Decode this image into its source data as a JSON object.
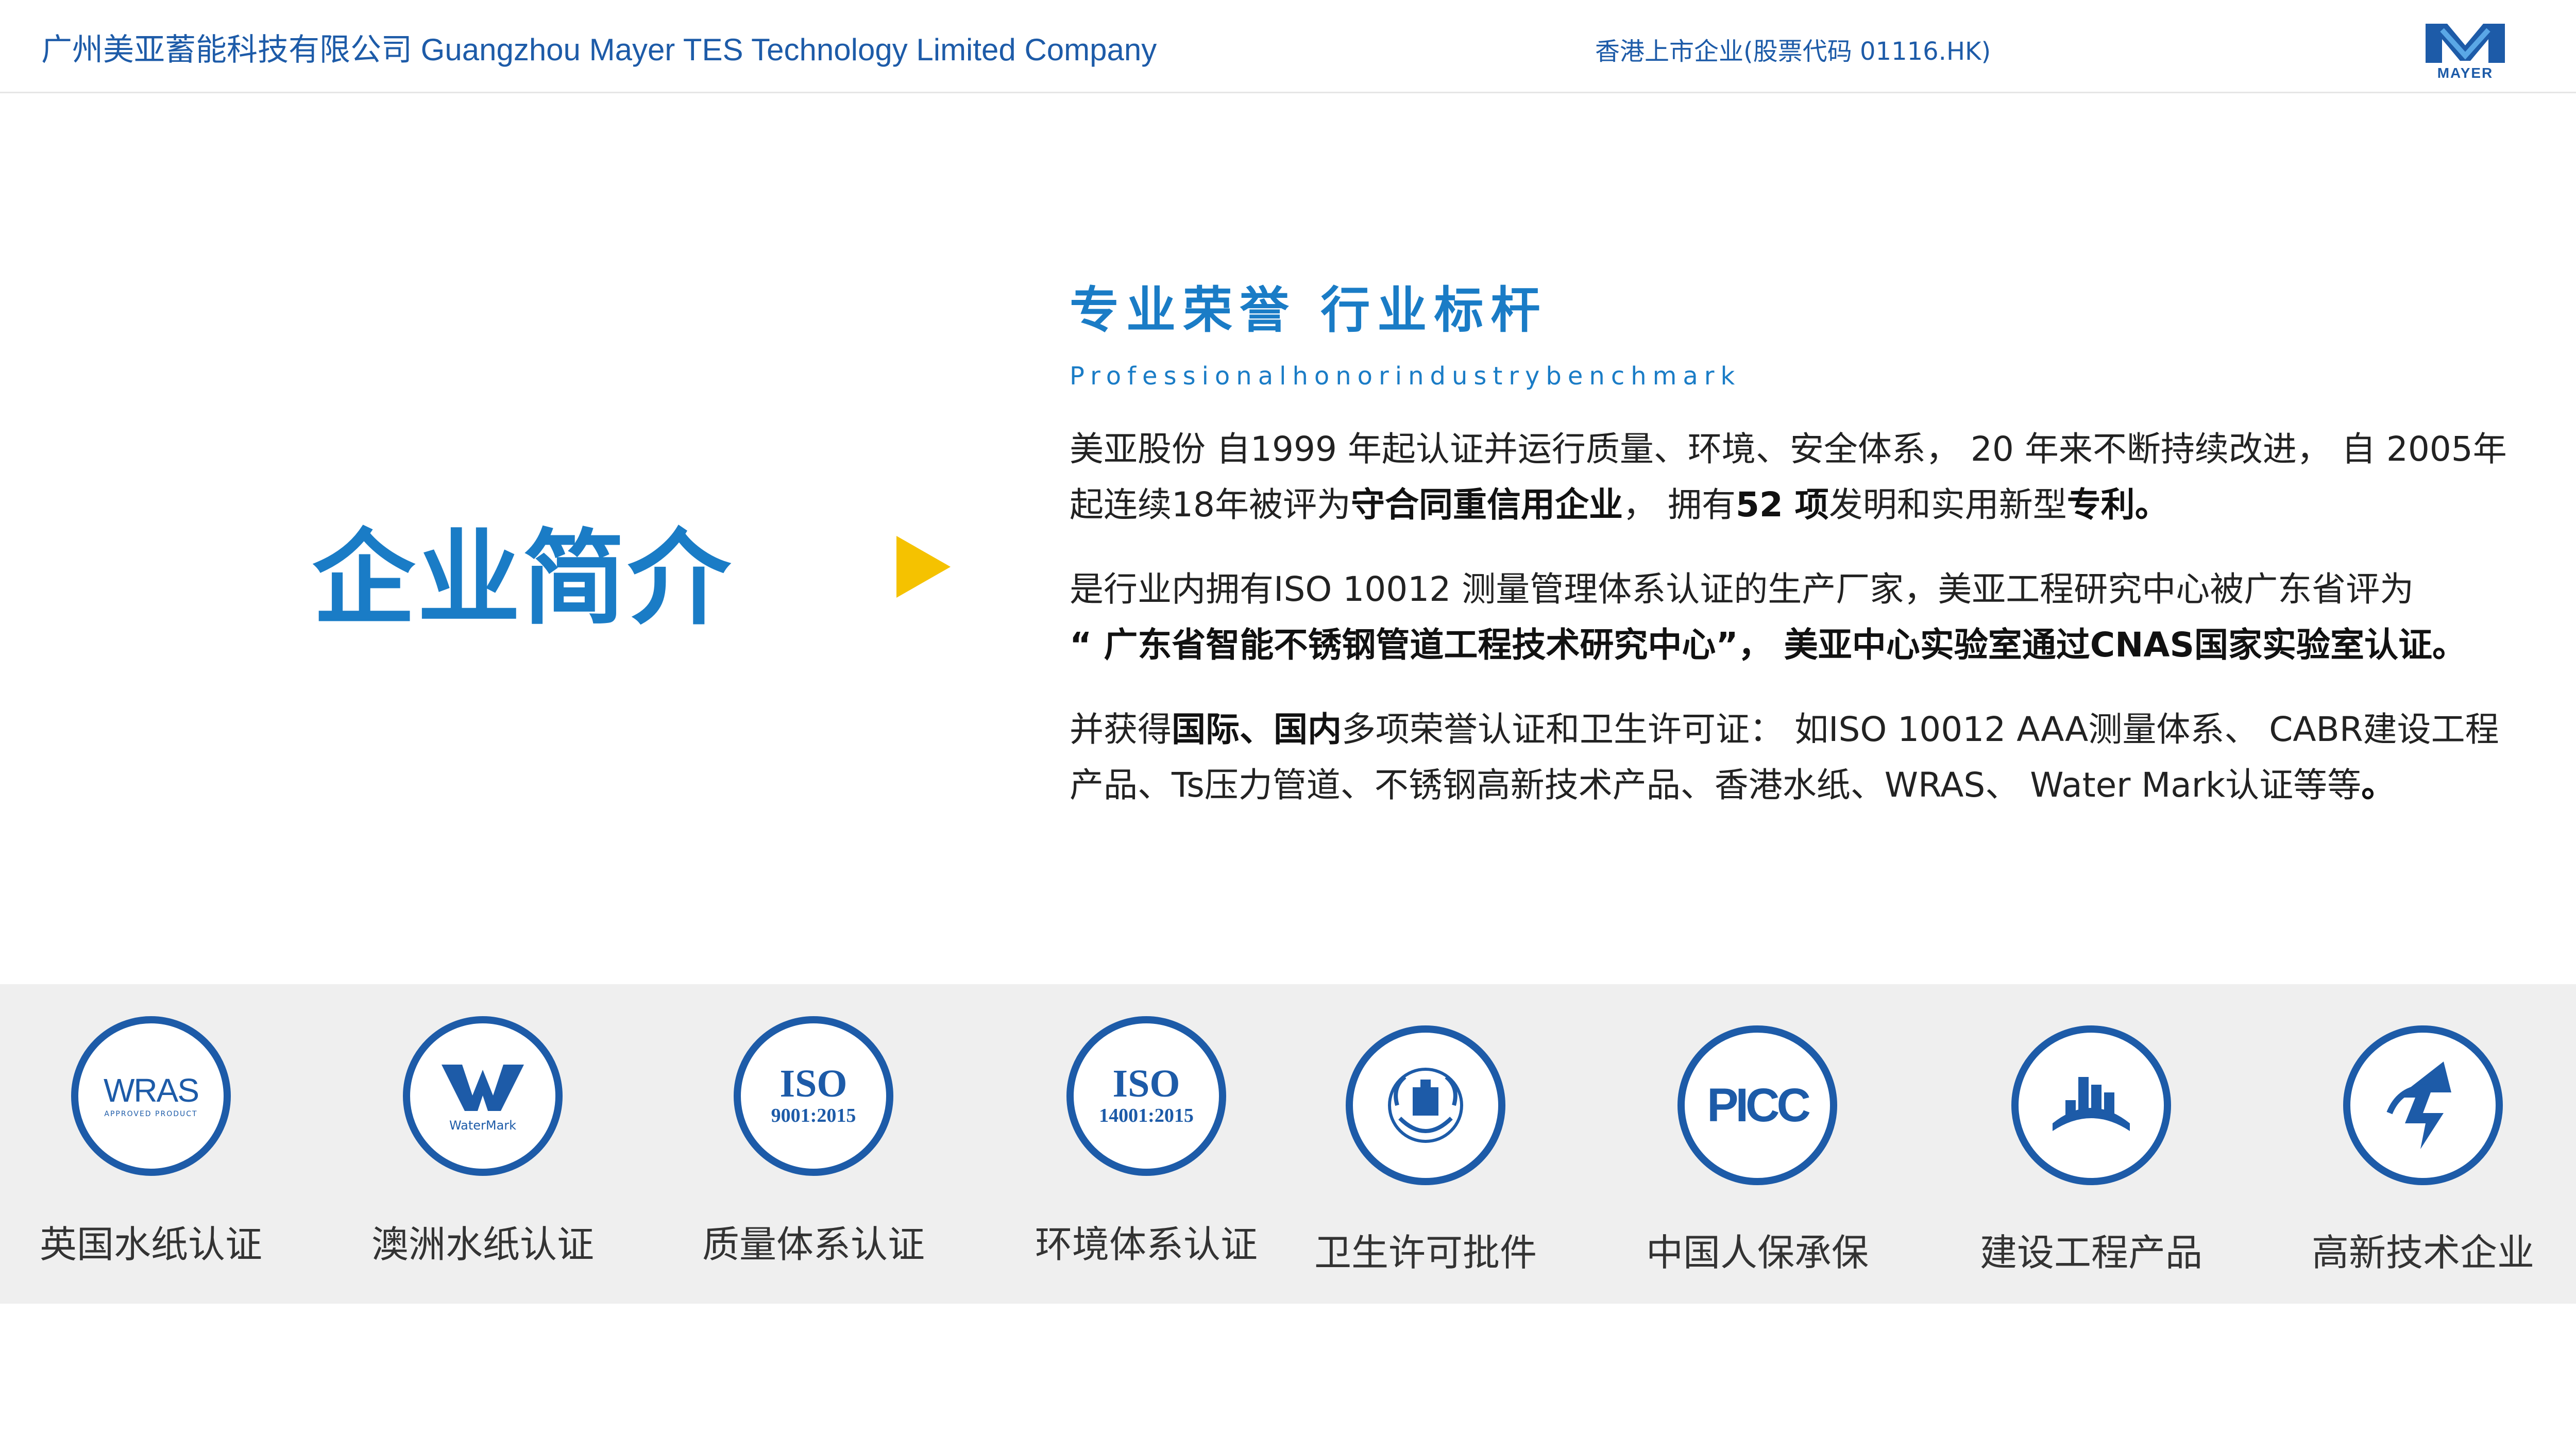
{
  "header": {
    "company_name": "广州美亚蓄能科技有限公司  Guangzhou Mayer TES Technology Limited Company",
    "listing": "香港上市企业(股票代码 01116.HK)",
    "logo_text": "MAYER",
    "logo_icon": "mayer-logo-icon"
  },
  "main": {
    "title": "企业简介",
    "arrow_icon": "play-arrow-icon",
    "section_title": "专业荣誉 行业标杆",
    "section_subtitle": "Professionalhonorindustrybenchmark",
    "paragraphs": [
      {
        "p1_a": "美亚股份 自1999 年起认证并运行质量、环境、安全体系， 20 年来不断持续改进， 自 2005年起连续18年被评为",
        "p1_b": "守合同重信用企业",
        "p1_c": "， 拥有",
        "p1_d": "52 项",
        "p1_e": "发明和实用新型",
        "p1_f": "专利。"
      },
      {
        "p2_a": "是行业内拥有ISO 10012 测量管理体系认证的生产厂家，美亚工程研究中心被广东省评为",
        "p2_b": "“ 广东省智能不锈钢管道工程技术研究中心”， 美亚中心实验室通过CNAS国家实验室认证。"
      },
      {
        "p3_a": "并获得",
        "p3_b": "国际、国内",
        "p3_c": "多项荣誉认证和卫生许可证： 如ISO 10012 AAA测量体系、 CABR建设工程产品、Ts压力管道、不锈钢高新技术产品、香港水纸、WRAS、 Water Mark认证等等",
        "p3_d": "。"
      }
    ]
  },
  "certifications": [
    {
      "label": "英国水纸认证",
      "icon": "wras-logo-icon",
      "logo_main": "WRAS",
      "logo_sub": "APPROVED PRODUCT"
    },
    {
      "label": "澳洲水纸认证",
      "icon": "watermark-logo-icon",
      "logo_main": "W",
      "logo_sub": "WaterMark"
    },
    {
      "label": "质量体系认证",
      "icon": "iso-9001-icon",
      "logo_main": "ISO",
      "logo_sub": "9001:2015"
    },
    {
      "label": "环境体系认证",
      "icon": "iso-14001-icon",
      "logo_main": "ISO",
      "logo_sub": "14001:2015"
    },
    {
      "label": "卫生许可批件",
      "icon": "health-permit-emblem-icon"
    },
    {
      "label": "中国人保承保",
      "icon": "picc-logo-icon",
      "logo_main": "PICC"
    },
    {
      "label": "建设工程产品",
      "icon": "cabr-logo-icon"
    },
    {
      "label": "高新技术企业",
      "icon": "high-tech-enterprise-icon"
    }
  ],
  "colors": {
    "brand_blue": "#1d5ba8",
    "title_blue": "#1a7cc6",
    "arrow_yellow": "#f5c200",
    "band_gray": "#efefef"
  }
}
